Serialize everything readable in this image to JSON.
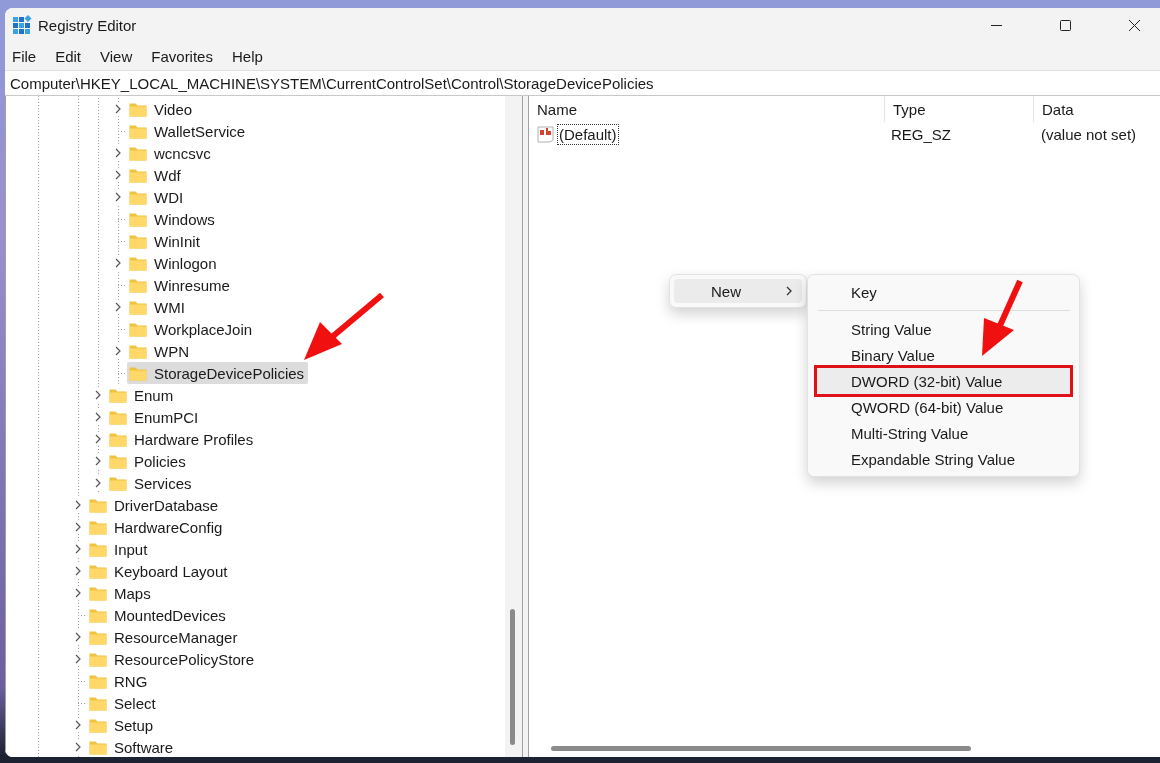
{
  "window": {
    "title": "Registry Editor"
  },
  "menu_bar": [
    "File",
    "Edit",
    "View",
    "Favorites",
    "Help"
  ],
  "address_bar": {
    "value": "Computer\\HKEY_LOCAL_MACHINE\\SYSTEM\\CurrentControlSet\\Control\\StorageDevicePolicies"
  },
  "tree": {
    "items": [
      {
        "children": [
          {
            "children": [
              {
                "label": "Video",
                "expandable": true,
                "selected": false
              },
              {
                "label": "WalletService",
                "expandable": false,
                "selected": false
              },
              {
                "label": "wcncsvc",
                "expandable": true,
                "selected": false
              },
              {
                "label": "Wdf",
                "expandable": true,
                "selected": false
              },
              {
                "label": "WDI",
                "expandable": true,
                "selected": false
              },
              {
                "label": "Windows",
                "expandable": false,
                "selected": false
              },
              {
                "label": "WinInit",
                "expandable": false,
                "selected": false
              },
              {
                "label": "Winlogon",
                "expandable": true,
                "selected": false
              },
              {
                "label": "Winresume",
                "expandable": false,
                "selected": false
              },
              {
                "label": "WMI",
                "expandable": true,
                "selected": false
              },
              {
                "label": "WorkplaceJoin",
                "expandable": false,
                "selected": false
              },
              {
                "label": "WPN",
                "expandable": true,
                "selected": false
              },
              {
                "label": "StorageDevicePolicies",
                "expandable": false,
                "selected": true
              }
            ]
          },
          {
            "label": "Enum",
            "expandable": true,
            "selected": false
          },
          {
            "label": "EnumPCI",
            "expandable": true,
            "selected": false
          },
          {
            "label": "Hardware Profiles",
            "expandable": true,
            "selected": false
          },
          {
            "label": "Policies",
            "expandable": true,
            "selected": false
          },
          {
            "label": "Services",
            "expandable": true,
            "selected": false
          }
        ]
      },
      {
        "label": "DriverDatabase",
        "expandable": true,
        "selected": false
      },
      {
        "label": "HardwareConfig",
        "expandable": true,
        "selected": false
      },
      {
        "label": "Input",
        "expandable": true,
        "selected": false
      },
      {
        "label": "Keyboard Layout",
        "expandable": true,
        "selected": false
      },
      {
        "label": "Maps",
        "expandable": true,
        "selected": false
      },
      {
        "label": "MountedDevices",
        "expandable": false,
        "selected": false
      },
      {
        "label": "ResourceManager",
        "expandable": true,
        "selected": false
      },
      {
        "label": "ResourcePolicyStore",
        "expandable": true,
        "selected": false
      },
      {
        "label": "RNG",
        "expandable": false,
        "selected": false
      },
      {
        "label": "Select",
        "expandable": false,
        "selected": false
      },
      {
        "label": "Setup",
        "expandable": true,
        "selected": false
      },
      {
        "label": "Software",
        "expandable": true,
        "selected": false
      }
    ]
  },
  "values_table": {
    "columns": [
      "Name",
      "Type",
      "Data"
    ],
    "rows": [
      {
        "name": "(Default)",
        "type": "REG_SZ",
        "data": "(value not set)",
        "focused": true
      }
    ]
  },
  "context_menu": {
    "items": [
      {
        "label": "New",
        "has_submenu": true,
        "selected": true
      }
    ],
    "submenu": {
      "items": [
        {
          "kind": "item",
          "label": "Key",
          "selected": false,
          "highlighted": false
        },
        {
          "kind": "separator"
        },
        {
          "kind": "item",
          "label": "String Value",
          "selected": false,
          "highlighted": false
        },
        {
          "kind": "item",
          "label": "Binary Value",
          "selected": false,
          "highlighted": false
        },
        {
          "kind": "item",
          "label": "DWORD (32-bit) Value",
          "selected": true,
          "highlighted": true
        },
        {
          "kind": "item",
          "label": "QWORD (64-bit) Value",
          "selected": false,
          "highlighted": false
        },
        {
          "kind": "item",
          "label": "Multi-String Value",
          "selected": false,
          "highlighted": false
        },
        {
          "kind": "item",
          "label": "Expandable String Value",
          "selected": false,
          "highlighted": false
        }
      ]
    }
  }
}
